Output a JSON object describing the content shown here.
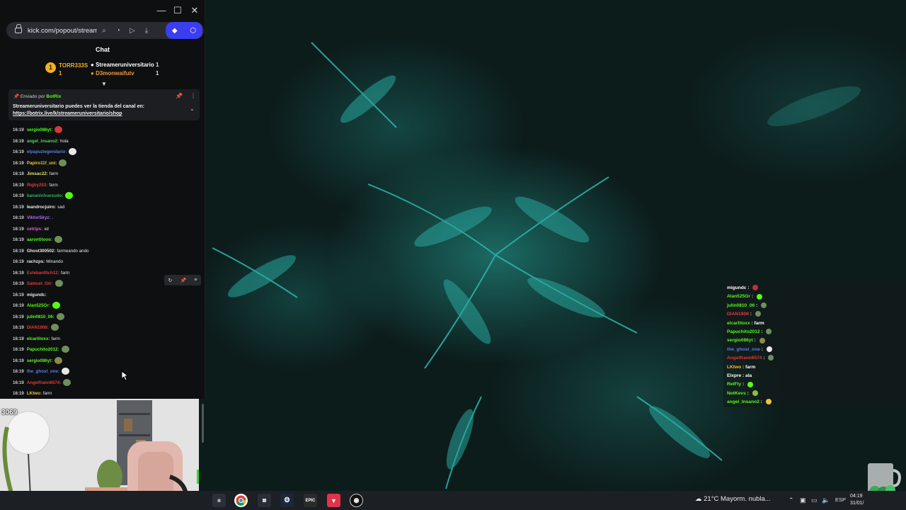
{
  "browser": {
    "url": "kick.com/popout/streame",
    "window_controls": [
      "—",
      "☐",
      "✕"
    ],
    "addr_icons": [
      "⌕",
      "◔",
      "▷",
      "⤓"
    ],
    "ext_icons": [
      "◆",
      "⬡"
    ]
  },
  "chat": {
    "title": "Chat",
    "leaderboard": {
      "rank": "1",
      "first_user": "TORR333S",
      "first_count": "1",
      "col2": [
        {
          "user": "Streameruniversitario",
          "count": "1"
        },
        {
          "user": "D3monwaifutv",
          "count": "1"
        }
      ]
    },
    "pinned": {
      "sent_by_label": "Enviado por",
      "bot_name": "BotRix",
      "message": "Streameruniversitario puedes ver la tienda del canal en:",
      "link": "https://botrix.live/k/streameruniversitario/shop"
    },
    "messages": [
      {
        "ts": "16:19",
        "user": "sergio086yt:",
        "text": "",
        "color": "#53fc18",
        "emote": "#d23a3a"
      },
      {
        "ts": "16:19",
        "user": "angel_insano2:",
        "text": "hola",
        "color": "#55d36d",
        "emote": ""
      },
      {
        "ts": "16:19",
        "user": "elpapuzlegendario:",
        "text": "",
        "color": "#5a7de0",
        "emote": "#e8e8e8"
      },
      {
        "ts": "16:19",
        "user": "Papiro11f_uni:",
        "text": "",
        "color": "#f0c23a",
        "emote": "#6f8f5a"
      },
      {
        "ts": "16:19",
        "user": "Jimsac22:",
        "text": "farm",
        "color": "#d9e06a",
        "emote": ""
      },
      {
        "ts": "16:19",
        "user": "Rigby253:",
        "text": "farm",
        "color": "#e03a3a",
        "emote": ""
      },
      {
        "ts": "16:19",
        "user": "bananinhuesudo:",
        "text": "",
        "color": "#2fae5a",
        "emote": "#53fc18"
      },
      {
        "ts": "16:19",
        "user": "leandrocjuiro:",
        "text": "sad",
        "color": "#e8e8e8",
        "emote": ""
      },
      {
        "ts": "16:19",
        "user": "ViktorSkyz:",
        "text": ".",
        "color": "#b070f0",
        "emote": ""
      },
      {
        "ts": "16:19",
        "user": "cetrips:",
        "text": "xd",
        "color": "#e85bd5",
        "emote": ""
      },
      {
        "ts": "16:19",
        "user": "aarontitooo:",
        "text": "",
        "color": "#53fc18",
        "emote": "#6f8f5a"
      },
      {
        "ts": "16:19",
        "user": "Ghost300502:",
        "text": "farmeando ando",
        "color": "#e8e8e8",
        "emote": ""
      },
      {
        "ts": "16:19",
        "user": "rachzps:",
        "text": "Minando",
        "color": "#e8e8e8",
        "emote": ""
      },
      {
        "ts": "16:19",
        "user": "Estebanfitch12:",
        "text": "farm",
        "color": "#e03a3a",
        "emote": ""
      },
      {
        "ts": "16:19",
        "user": "Samuel_Gtr:",
        "text": "",
        "color": "#e03a3a",
        "emote": "#6f8f5a"
      },
      {
        "ts": "16:19",
        "user": "migundc:",
        "text": "",
        "color": "#e8e8e8",
        "emote": ""
      },
      {
        "ts": "16:19",
        "user": "Alan525Gr:",
        "text": "",
        "color": "#53fc18",
        "emote": "#53fc18"
      },
      {
        "ts": "16:19",
        "user": "julin0810_06:",
        "text": "",
        "color": "#53fc18",
        "emote": "#6f8f5a"
      },
      {
        "ts": "16:19",
        "user": "DIAN1908:",
        "text": "",
        "color": "#e03a3a",
        "emote": "#6f8f5a"
      },
      {
        "ts": "16:19",
        "user": "elcarlitoxx:",
        "text": "farm",
        "color": "#53fc18",
        "emote": ""
      },
      {
        "ts": "16:19",
        "user": "Papuchito2012:",
        "text": "",
        "color": "#53fc18",
        "emote": "#6f8f5a"
      },
      {
        "ts": "16:19",
        "user": "sergio086yt:",
        "text": "",
        "color": "#53fc18",
        "emote": "#8a8a4a"
      },
      {
        "ts": "16:19",
        "user": "the_ghost_one:",
        "text": "",
        "color": "#5a7de0",
        "emote": "#e8e8e8"
      },
      {
        "ts": "16:19",
        "user": "Angelfrann6574:",
        "text": "",
        "color": "#e03a3a",
        "emote": "#6f8f5a"
      },
      {
        "ts": "16:19",
        "user": "LKtwo:",
        "text": "farm",
        "color": "#f0c23a",
        "emote": ""
      }
    ],
    "hover_tools": [
      "↻",
      "📌",
      "≡"
    ]
  },
  "webcam": {
    "viewer_count": "3069"
  },
  "overlay": {
    "lines": [
      {
        "user": "migundc",
        "text": "",
        "color": "#ffffff",
        "emote": "#c03030"
      },
      {
        "user": "Alan525Gr",
        "text": "",
        "color": "#53fc18",
        "emote": "#53fc18"
      },
      {
        "user": "julin0810_06",
        "text": "",
        "color": "#53fc18",
        "emote": "#6f8f5a"
      },
      {
        "user": "DIAN1908",
        "text": "",
        "color": "#e03a3a",
        "emote": "#6f8f5a"
      },
      {
        "user": "elcarlitoxx",
        "text": "farm",
        "color": "#53fc18",
        "emote": ""
      },
      {
        "user": "Papuchito2012",
        "text": "",
        "color": "#53fc18",
        "emote": "#6f8f5a"
      },
      {
        "user": "sergio086yt",
        "text": "",
        "color": "#53fc18",
        "emote": "#8a8a4a"
      },
      {
        "user": "the_ghost_one",
        "text": "",
        "color": "#5a7de0",
        "emote": "#e8e8e8"
      },
      {
        "user": "Angelfrann6574",
        "text": "",
        "color": "#e03a3a",
        "emote": "#6f8f5a"
      },
      {
        "user": "LKtwo",
        "text": "farm",
        "color": "#f0c23a",
        "emote": ""
      },
      {
        "user": "Elxpre",
        "text": "ala",
        "color": "#ffffff",
        "emote": ""
      },
      {
        "user": "RetFly",
        "text": "",
        "color": "#53fc18",
        "emote": "#53fc18"
      },
      {
        "user": "NotKevs",
        "text": "",
        "color": "#53fc18",
        "emote": "#8ac03a"
      },
      {
        "user": "angel_Insano2",
        "text": "",
        "color": "#53fc18",
        "emote": "#f0c23a"
      }
    ]
  },
  "taskbar": {
    "apps": [
      "chrome-icon",
      "files-icon",
      "steam-icon",
      "epic-icon",
      "app-red-icon",
      "obs-icon"
    ],
    "epic_label": "EPIC",
    "weather": "21°C  Mayorm. nubla...",
    "lang": "ESP",
    "time": "04:19",
    "date": "31/01/"
  }
}
